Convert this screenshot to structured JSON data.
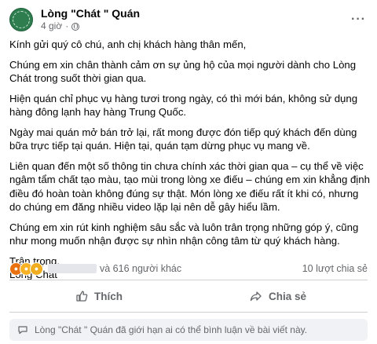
{
  "page": {
    "name": "Lòng \"Chát \" Quán",
    "time": "4 giờ",
    "more": "···"
  },
  "post": {
    "greeting": "Kính gửi quý cô chú, anh chị khách hàng thân mến,",
    "p1": "Chúng em xin chân thành cảm ơn sự ủng hộ của mọi người dành cho Lòng Chát trong suốt thời gian qua.",
    "p2": "Hiện quán chỉ phục vụ hàng tươi trong ngày, có thì mới bán, không sử dụng hàng đông lạnh hay hàng Trung Quốc.",
    "p3": "Ngày mai quán mở bán trở lại, rất mong được đón tiếp quý khách đến dùng bữa trực tiếp tại quán. Hiện tại, quán tạm dừng phục vụ mang về.",
    "p4": "Liên quan đến một số thông tin chưa chính xác thời gian qua – cụ thể về việc ngâm tẩm chất tạo màu, tạo mùi trong lòng xe điếu – chúng em xin khẳng định điều đó hoàn toàn không đúng sự thật. Món lòng xe điếu rất ít khi có, nhưng do chúng em đăng nhiều video lặp lại nên dễ gây hiểu lầm.",
    "p5": "Chúng em xin rút kinh nghiệm sâu sắc và luôn trân trọng những góp ý, cũng như mong muốn nhận được sự nhìn nhận công tâm từ quý khách hàng.",
    "closing": "Trân trọng,",
    "signature": "Lòng Chát"
  },
  "stats": {
    "others": "và 616 người khác",
    "shares": "10 lượt chia sẻ"
  },
  "actions": {
    "like": "Thích",
    "share": "Chia sẻ"
  },
  "comments": {
    "notice": "Lòng \"Chát \" Quán đã giới hạn ai có thể bình luận về bài viết này."
  }
}
